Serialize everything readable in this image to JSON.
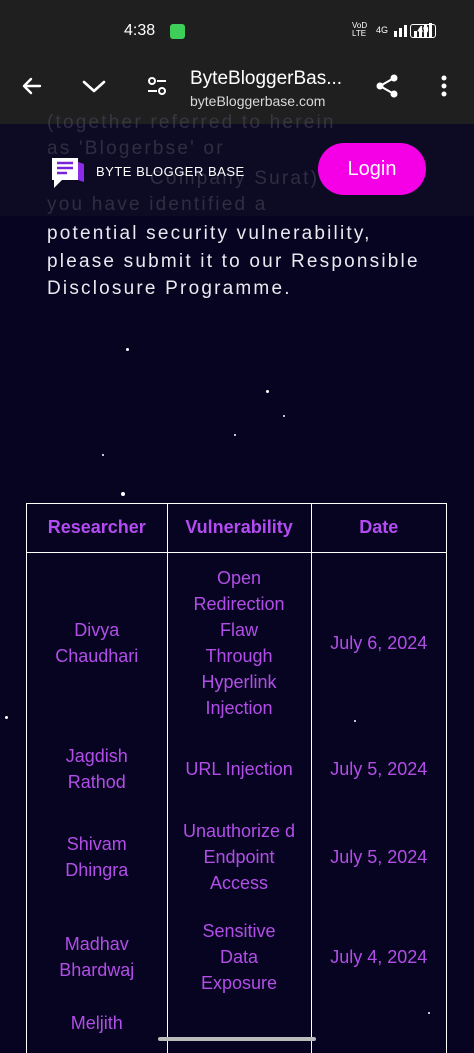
{
  "status": {
    "time": "4:38",
    "network": "4G",
    "network_left": "VoD LTE",
    "battery": "49"
  },
  "browser": {
    "tab_title": "ByteBloggerBas...",
    "url": "byteBloggerbase.com"
  },
  "header": {
    "logo_text": "BYTE BLOGGER BASE",
    "login_label": "Login",
    "ghost_lines": [
      "(together referred to herein",
      "as 'Blogerbse' or",
      "Company Surat) If you",
      "you have identified a"
    ]
  },
  "content": {
    "paragraph": "potential security vulnerability, please submit it to our Responsible Disclosure Programme."
  },
  "table": {
    "headers": [
      "Researcher",
      "Vulnerability",
      "Date"
    ],
    "rows": [
      {
        "researcher": "Divya Chaudhari",
        "vulnerability": "Open Redirection Flaw Through Hyperlink Injection",
        "date": "July 6, 2024"
      },
      {
        "researcher": "Jagdish Rathod",
        "vulnerability": "URL Injection",
        "date": "July 5, 2024"
      },
      {
        "researcher": "Shivam Dhingra",
        "vulnerability": "Unauthorize d Endpoint Access",
        "date": "July 5, 2024"
      },
      {
        "researcher": "Madhav Bhardwaj",
        "vulnerability": "Sensitive Data Exposure",
        "date": "July 4, 2024"
      },
      {
        "researcher": "Meljith",
        "vulnerability": "",
        "date": ""
      }
    ]
  },
  "colors": {
    "background": "#070421",
    "accent": "#f500e6",
    "table_text": "#b24ee8"
  }
}
